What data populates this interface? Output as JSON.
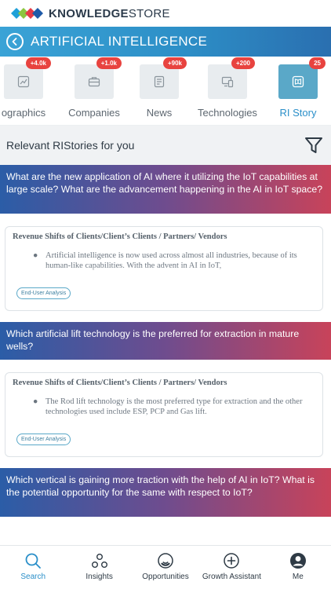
{
  "brand": {
    "bold": "KNOWLEDGE",
    "light": "STORE"
  },
  "header": {
    "title": "ARTIFICIAL INTELLIGENCE"
  },
  "categories": [
    {
      "label": "ographics",
      "badge": "+4.0k",
      "icon": "chart-icon",
      "active": false
    },
    {
      "label": "Companies",
      "badge": "+1.0k",
      "icon": "briefcase-icon",
      "active": false
    },
    {
      "label": "News",
      "badge": "+90k",
      "icon": "news-icon",
      "active": false
    },
    {
      "label": "Technologies",
      "badge": "+200",
      "icon": "devices-icon",
      "active": false
    },
    {
      "label": "RI Story",
      "badge": "25",
      "icon": "book-icon",
      "active": true
    }
  ],
  "section": {
    "title": "Relevant RIStories for you",
    "filter_icon": "filter-icon"
  },
  "stories": [
    {
      "question": "What are the new application of AI where it utilizing the IoT capabilities at large scale? What are the advancement happening in the AI in IoT space?",
      "card_title": "Revenue Shifts of Clients/Client’s Clients / Partners/ Vendors",
      "bullet": "Artificial intelligence  is now used across almost all industries, because of its human-like capabilities. With the advent in AI in IoT,",
      "tag": "End-User Analysis"
    },
    {
      "question": "Which artificial lift technology is the preferred for extraction in mature wells?",
      "card_title": "Revenue Shifts of Clients/Client’s Clients / Partners/ Vendors",
      "bullet": "The Rod lift technology is the most preferred type for extraction and the other technologies used include ESP, PCP and Gas lift.",
      "tag": "End-User Analysis"
    },
    {
      "question": "Which vertical is gaining more traction with the help of AI in IoT? What is the potential opportunity for the same with respect to IoT?"
    }
  ],
  "bottom_nav": [
    {
      "label": "Search",
      "icon": "search-icon",
      "active": true
    },
    {
      "label": "Insights",
      "icon": "insights-icon",
      "active": false
    },
    {
      "label": "Opportunities",
      "icon": "opportunities-icon",
      "active": false
    },
    {
      "label": "Growth Assistant",
      "icon": "plus-circle-icon",
      "active": false
    },
    {
      "label": "Me",
      "icon": "user-icon",
      "active": false
    }
  ],
  "colors": {
    "accent": "#2a8fc9",
    "badge": "#e8433f",
    "active_tile": "#5aa8c8"
  }
}
